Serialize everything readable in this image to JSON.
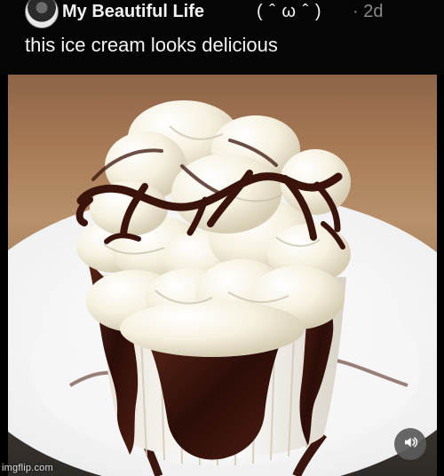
{
  "post": {
    "author_name": "My Beautiful Life",
    "author_kaomoji": "( ˆ ω ˆ )",
    "timestamp": "· 2d",
    "caption": "this ice cream looks delicious"
  },
  "media": {
    "type": "photo",
    "subject": "ice cream",
    "volume_icon": "speaker-icon"
  },
  "watermark": {
    "text": "imgflip.com"
  },
  "colors": {
    "background": "#000000",
    "text": "#f2f2f2",
    "muted_text": "#8a8a8a",
    "chocolate": "#3b160e",
    "cream": "#f3efe2"
  }
}
